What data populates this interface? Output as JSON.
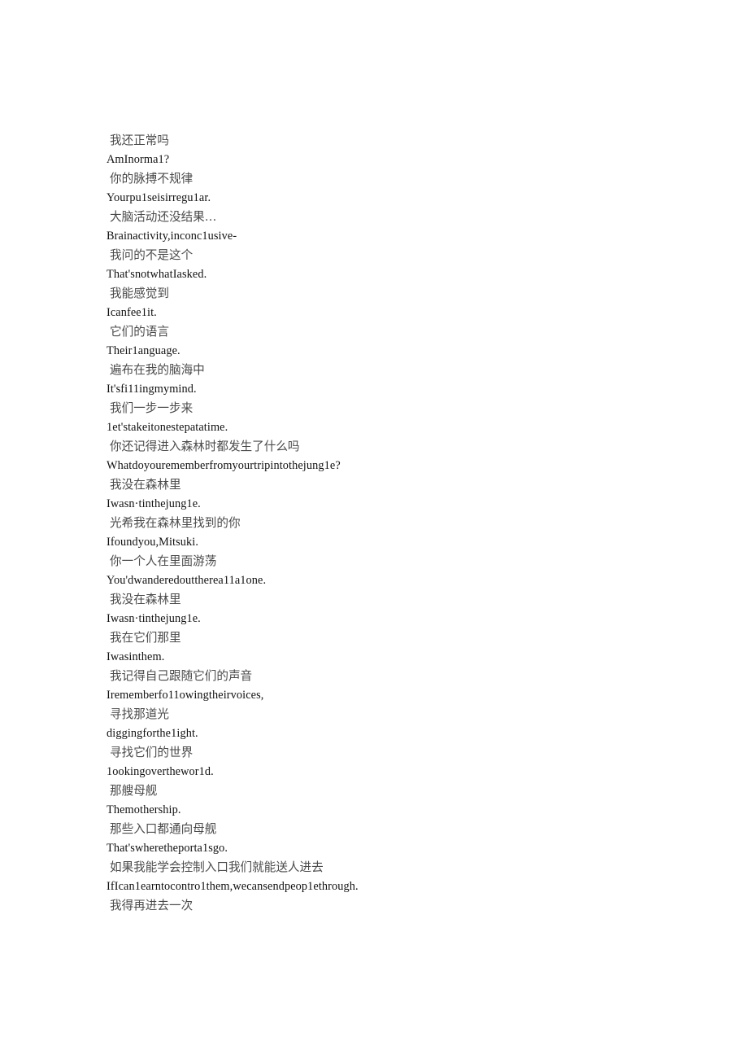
{
  "document": {
    "background_color": "#ffffff",
    "zh_text_color": "#4a4a4a",
    "en_text_color": "#111111",
    "lines": [
      {
        "lang": "zh",
        "text": "我还正常吗"
      },
      {
        "lang": "en",
        "text": "AmInorma1?"
      },
      {
        "lang": "zh",
        "text": "你的脉搏不规律"
      },
      {
        "lang": "en",
        "text": "Yourpu1seisirregu1ar."
      },
      {
        "lang": "zh",
        "text": "大脑活动还没结果…"
      },
      {
        "lang": "en",
        "text": "Brainactivity,inconc1usive-"
      },
      {
        "lang": "zh",
        "text": "我问的不是这个"
      },
      {
        "lang": "en",
        "text": "That'snotwhatIasked."
      },
      {
        "lang": "zh",
        "text": "我能感觉到"
      },
      {
        "lang": "en",
        "text": "Icanfee1it."
      },
      {
        "lang": "zh",
        "text": "它们的语言"
      },
      {
        "lang": "en",
        "text": "Their1anguage."
      },
      {
        "lang": "zh",
        "text": "遍布在我的脑海中"
      },
      {
        "lang": "en",
        "text": "It'sfi11ingmymind."
      },
      {
        "lang": "zh",
        "text": "我们一步一步来"
      },
      {
        "lang": "en",
        "text": "1et'stakeitonestepatatime."
      },
      {
        "lang": "zh",
        "text": "你还记得进入森林时都发生了什么吗"
      },
      {
        "lang": "en",
        "text": "Whatdoyourememberfromyourtripintothejung1e?"
      },
      {
        "lang": "zh",
        "text": "我没在森林里"
      },
      {
        "lang": "en",
        "text": "Iwasn·tinthejung1e."
      },
      {
        "lang": "zh",
        "text": "光希我在森林里找到的你"
      },
      {
        "lang": "en",
        "text": "Ifoundyou,Mitsuki."
      },
      {
        "lang": "zh",
        "text": "你一个人在里面游荡"
      },
      {
        "lang": "en",
        "text": "You'dwanderedouttherea11a1one."
      },
      {
        "lang": "zh",
        "text": "我没在森林里"
      },
      {
        "lang": "en",
        "text": "Iwasn·tinthejung1e."
      },
      {
        "lang": "zh",
        "text": "我在它们那里"
      },
      {
        "lang": "en",
        "text": "Iwasinthem."
      },
      {
        "lang": "zh",
        "text": "我记得自己跟随它们的声音"
      },
      {
        "lang": "en",
        "text": "Irememberfo11owingtheirvoices,"
      },
      {
        "lang": "zh",
        "text": "寻找那道光"
      },
      {
        "lang": "en",
        "text": "diggingforthe1ight."
      },
      {
        "lang": "zh",
        "text": "寻找它们的世界"
      },
      {
        "lang": "en",
        "text": "1ookingoverthewor1d."
      },
      {
        "lang": "zh",
        "text": "那艘母舰"
      },
      {
        "lang": "en",
        "text": "Themothership."
      },
      {
        "lang": "zh",
        "text": "那些入口都通向母舰"
      },
      {
        "lang": "en",
        "text": "That'swheretheporta1sgo."
      },
      {
        "lang": "zh",
        "text": "如果我能学会控制入口我们就能送人进去"
      },
      {
        "lang": "en",
        "text": "IfIcan1earntocontro1them,wecansendpeop1ethrough."
      },
      {
        "lang": "zh",
        "text": "我得再进去一次"
      }
    ]
  }
}
